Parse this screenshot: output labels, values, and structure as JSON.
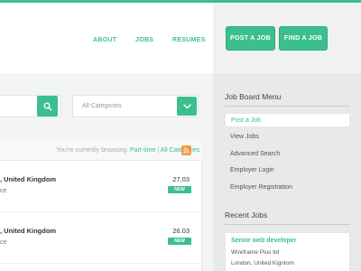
{
  "nav": {
    "about": "ABOUT",
    "jobs": "JOBS",
    "resumes": "RESUMES",
    "post_job": "POST A JOB",
    "find_job": "FIND A JOB"
  },
  "search": {
    "category_placeholder": "All Categories"
  },
  "browse": {
    "prefix": "You're currently browsing:",
    "type_link": "Part-time",
    "separator": "|",
    "category_link": "All Categories"
  },
  "jobs": [
    {
      "location": ", United Kingdom",
      "type": "ce",
      "date": "27.03",
      "badge": "NEW"
    },
    {
      "location": ", United Kingdom",
      "type": "ce",
      "date": "26.03",
      "badge": "NEW"
    }
  ],
  "sidebar": {
    "menu_title": "Job Board Menu",
    "items": [
      {
        "label": "Post a Job"
      },
      {
        "label": "View Jobs"
      },
      {
        "label": "Advanced Search"
      },
      {
        "label": "Employer Login"
      },
      {
        "label": "Employer Registration"
      }
    ],
    "recent_title": "Recent Jobs",
    "recent": {
      "title": "Senior web developer",
      "company": "Wireframe Plus ltd",
      "location": "London, United Kigntom"
    }
  },
  "colors": {
    "accent": "#3bbf8f",
    "rss": "#f2994a"
  }
}
